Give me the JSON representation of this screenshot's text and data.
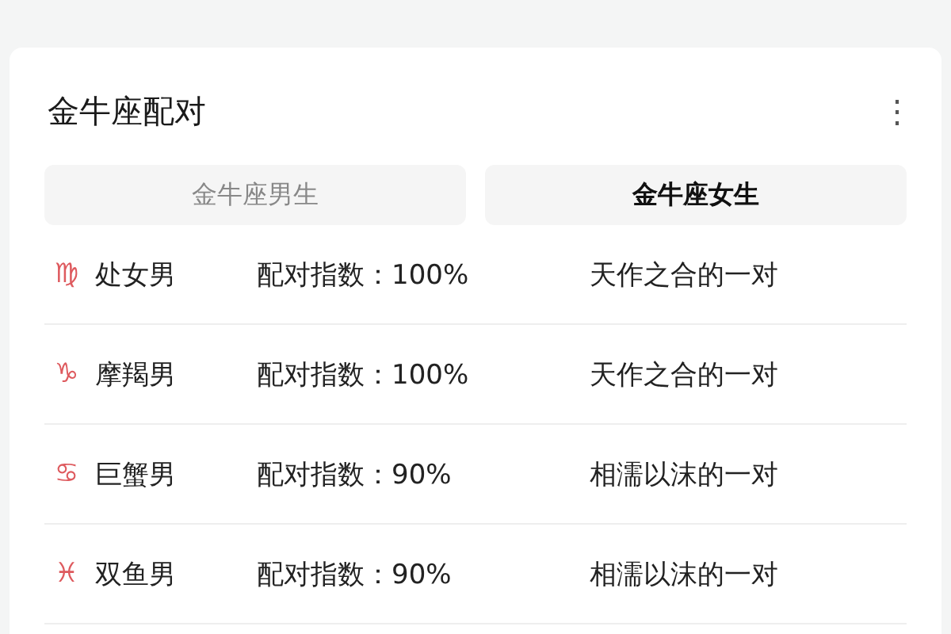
{
  "card": {
    "title": "金牛座配对",
    "menu": "⋮"
  },
  "tabs": [
    {
      "label": "金牛座男生",
      "selected": false
    },
    {
      "label": "金牛座女生",
      "selected": true
    }
  ],
  "rows": [
    {
      "sign": "♍",
      "name": "处女男",
      "score": "配对指数：100%",
      "verdict": "天作之合的一对"
    },
    {
      "sign": "♑",
      "name": "摩羯男",
      "score": "配对指数：100%",
      "verdict": "天作之合的一对"
    },
    {
      "sign": "♋",
      "name": "巨蟹男",
      "score": "配对指数：90%",
      "verdict": "相濡以沫的一对"
    },
    {
      "sign": "♓",
      "name": "双鱼男",
      "score": "配对指数：90%",
      "verdict": "相濡以沫的一对"
    }
  ]
}
